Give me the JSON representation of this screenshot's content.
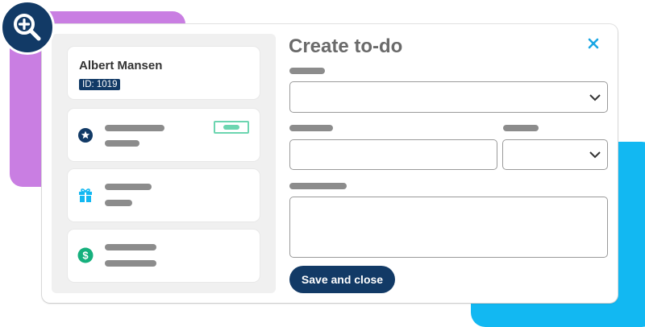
{
  "form": {
    "title": "Create to-do",
    "save_label": "Save and close"
  },
  "contact": {
    "name": "Albert Mansen",
    "id_label": "ID: 1019"
  },
  "icons": {
    "zoom": "zoom-in-icon",
    "close": "close-icon",
    "star": "star-icon",
    "gift": "gift-icon",
    "dollar": "dollar-icon",
    "chevron": "chevron-down-icon"
  },
  "colors": {
    "navy": "#123a66",
    "purple_accent": "#c97ee2",
    "blue_accent": "#12b8f2",
    "mint": "#6cd5b0",
    "green": "#16b07d",
    "close": "#1aa6e4",
    "placeholder_bar": "#8c8c8c"
  }
}
